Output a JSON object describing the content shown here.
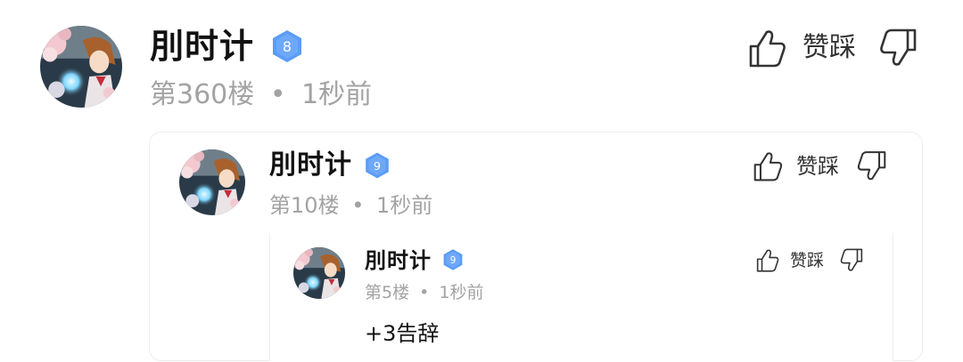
{
  "comments": [
    {
      "username": "刖时计",
      "level": "8",
      "floor": "第360楼",
      "separator": "•",
      "time": "1秒前",
      "vote_up_label": "赞",
      "vote_down_label": "踩"
    },
    {
      "username": "刖时计",
      "level": "9",
      "floor": "第10楼",
      "separator": "•",
      "time": "1秒前",
      "vote_up_label": "赞",
      "vote_down_label": "踩"
    },
    {
      "username": "刖时计",
      "level": "9",
      "floor": "第5楼",
      "separator": "•",
      "time": "1秒前",
      "vote_up_label": "赞",
      "vote_down_label": "踩",
      "content": "+3告辞"
    }
  ],
  "colors": {
    "badge": "#5b9cf5",
    "meta_text": "#a3a3a3",
    "avatar_bg": "#2a3a48",
    "avatar_glow": "#7fd6ff",
    "avatar_hair": "#a8612d",
    "avatar_flower": "#f3c9cf"
  },
  "icons": [
    "avatar",
    "level-badge-icon",
    "thumbs-up-icon",
    "thumbs-down-icon"
  ]
}
